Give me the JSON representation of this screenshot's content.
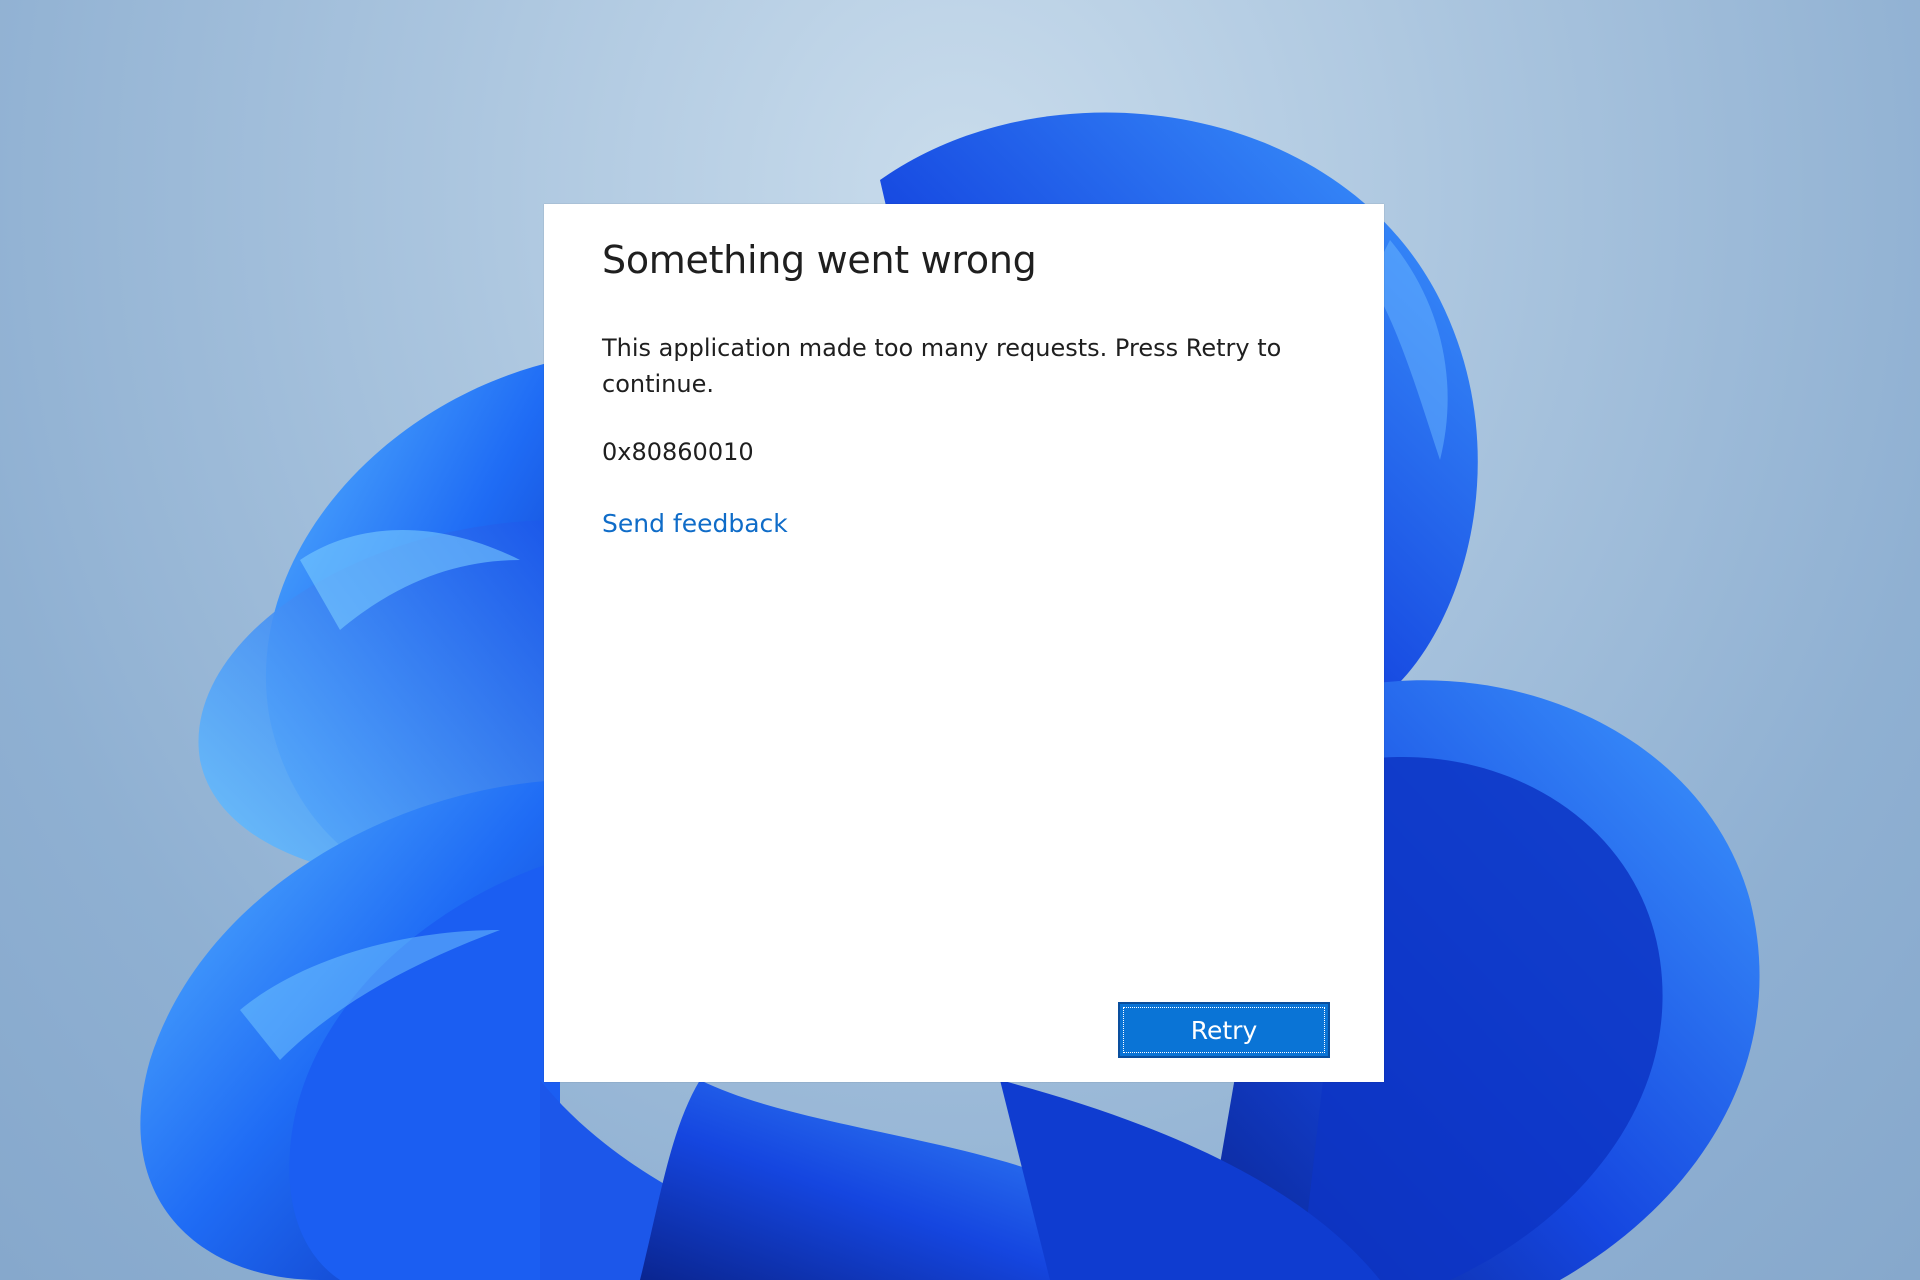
{
  "dialog": {
    "title": "Something went wrong",
    "message": "This application made too many requests. Press Retry to continue.",
    "error_code": "0x80860010",
    "feedback_link": "Send feedback",
    "retry_button": "Retry"
  },
  "colors": {
    "link": "#0f6cc8",
    "button_background": "#0a74d6",
    "dialog_background": "#ffffff",
    "wallpaper_bloom": "#1f5ff0"
  }
}
